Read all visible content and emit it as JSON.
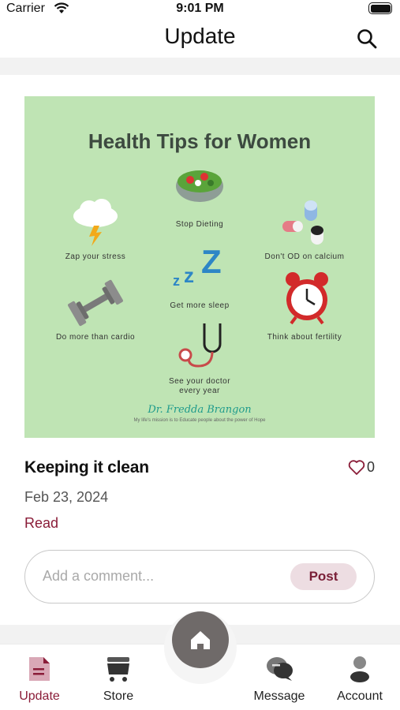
{
  "status_bar": {
    "carrier": "Carrier",
    "time": "9:01 PM"
  },
  "header": {
    "title": "Update",
    "search_icon": "search-icon"
  },
  "post": {
    "poster": {
      "title": "Health Tips for Women",
      "tips": [
        "Stop Dieting",
        "Zap your stress",
        "Don't OD on calcium",
        "Get more sleep",
        "Do more than cardio",
        "Think about fertility",
        "See your doctor every year"
      ],
      "signature": "Dr. Fredda Brangon",
      "signature_tagline": "My life's mission is to Educate people about the power of Hope",
      "background_color": "#bfe4b4"
    },
    "title": "Keeping it clean",
    "likes": "0",
    "date": "Feb 23, 2024",
    "read_label": "Read",
    "comment_placeholder": "Add a comment...",
    "post_button": "Post"
  },
  "tab_bar": {
    "tabs": [
      {
        "label": "Update",
        "icon": "document-icon",
        "active": true
      },
      {
        "label": "Store",
        "icon": "cart-icon",
        "active": false
      },
      {
        "label": "Message",
        "icon": "chat-icon",
        "active": false
      },
      {
        "label": "Account",
        "icon": "person-icon",
        "active": false
      }
    ],
    "home_icon": "home-icon"
  },
  "colors": {
    "accent": "#8a1c38",
    "post_button_bg": "#eddde2",
    "home_button": "#6f6a69"
  }
}
